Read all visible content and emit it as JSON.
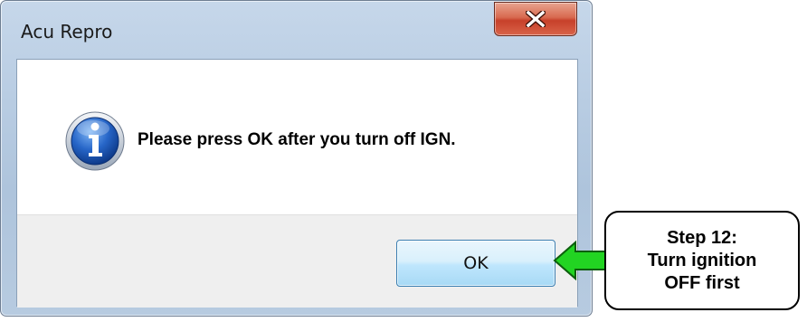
{
  "window": {
    "title": "Acu Repro",
    "close_glyph": "X"
  },
  "dialog": {
    "icon": "info-icon",
    "message": "Please press OK after you turn off IGN.",
    "ok_label": "OK"
  },
  "callout": {
    "lines": [
      "Step 12:",
      "Turn ignition",
      "OFF first"
    ],
    "arrow_color": "#22d422"
  },
  "colors": {
    "frame": "#b9cde3",
    "close_button": "#c7402a",
    "ok_button": "#bee6fd",
    "button_area": "#efefef"
  }
}
